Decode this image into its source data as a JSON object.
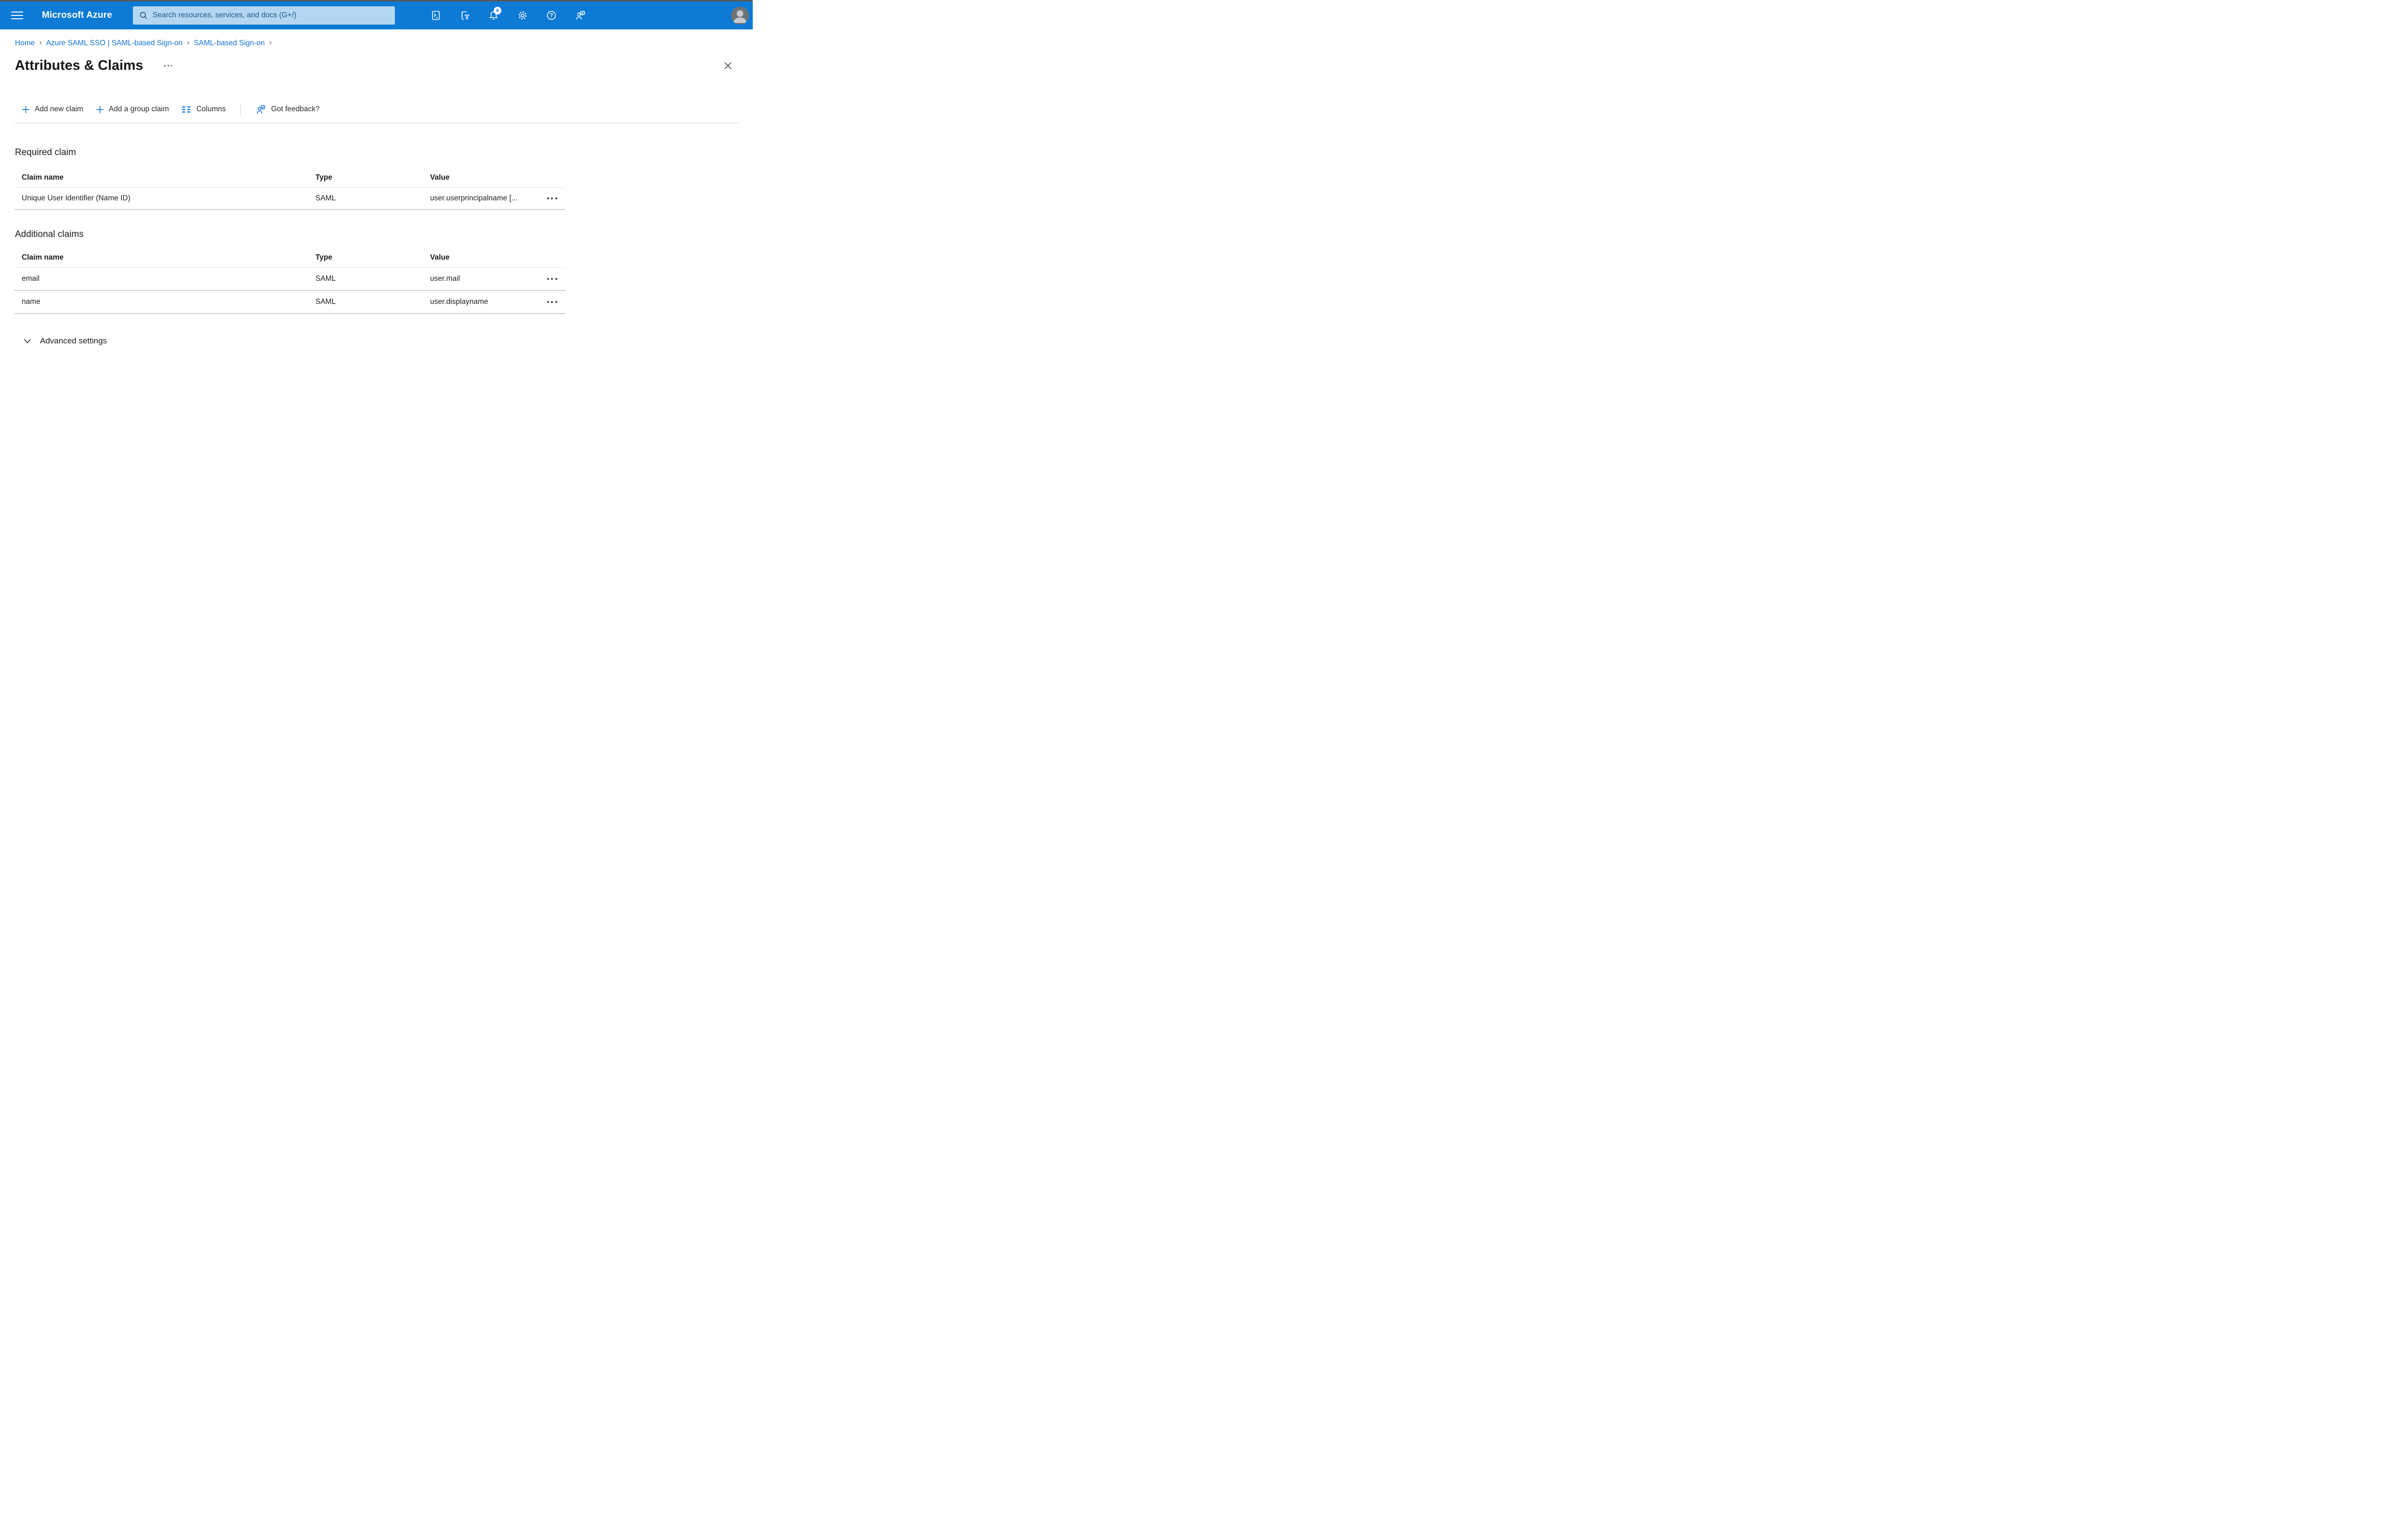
{
  "topbar": {
    "brand": "Microsoft Azure",
    "search_placeholder": "Search resources, services, and docs (G+/)",
    "notification_count": "6",
    "icons": [
      "hamburger-menu-icon",
      "search-icon",
      "cloud-shell-icon",
      "directory-filter-icon",
      "notifications-bell-icon",
      "settings-gear-icon",
      "help-icon",
      "feedback-icon",
      "avatar"
    ]
  },
  "breadcrumb": {
    "separator": "›",
    "items": [
      "Home",
      "Azure SAML SSO | SAML-based Sign-on",
      "SAML-based Sign-on"
    ]
  },
  "page": {
    "title": "Attributes & Claims",
    "more_options_icon": "ellipsis-icon",
    "close_icon": "close-icon"
  },
  "toolbar": {
    "add_new_claim": "Add new claim",
    "add_group_claim": "Add a group claim",
    "columns": "Columns",
    "got_feedback": "Got feedback?"
  },
  "required_claim": {
    "heading": "Required claim",
    "columns": {
      "name": "Claim name",
      "type": "Type",
      "value": "Value"
    },
    "rows": [
      {
        "name": "Unique User Identifier (Name ID)",
        "type": "SAML",
        "value": "user.userprincipalname [..."
      }
    ]
  },
  "additional_claims": {
    "heading": "Additional claims",
    "columns": {
      "name": "Claim name",
      "type": "Type",
      "value": "Value"
    },
    "rows": [
      {
        "name": "email",
        "type": "SAML",
        "value": "user.mail"
      },
      {
        "name": "name",
        "type": "SAML",
        "value": "user.displayname"
      }
    ]
  },
  "advanced": {
    "label": "Advanced settings"
  },
  "colors": {
    "topbar_blue": "#0d7ad5",
    "search_bg": "#b3d7f2",
    "search_text": "#235a88",
    "accent_blue": "#1373d6",
    "row_border": "#d3d1cf",
    "text_primary": "#242321"
  }
}
